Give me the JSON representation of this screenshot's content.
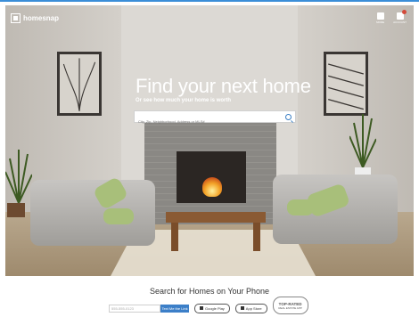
{
  "app": {
    "logo_text": "homesnap"
  },
  "header": {
    "icons": [
      {
        "name": "menu-icon",
        "label": "MORE"
      },
      {
        "name": "account-icon",
        "label": "ACCOUNT"
      }
    ]
  },
  "hero": {
    "headline": "Find your next home",
    "subheadline": "Or see how much your home is worth",
    "search": {
      "placeholder": "City, Zip, Neighborhood, Address or MLS#",
      "value": ""
    }
  },
  "bottom": {
    "title": "Search for Homes on Your Phone",
    "phone_placeholder": "555-555-0123",
    "text_button": "Text Me the Link",
    "google_play": "Google Play",
    "app_store": "App Store",
    "rated_title": "TOP-RATED",
    "rated_sub": "REAL ESTATE APP"
  },
  "colors": {
    "accent": "#3c7fc8",
    "badge": "#d44a3a"
  }
}
